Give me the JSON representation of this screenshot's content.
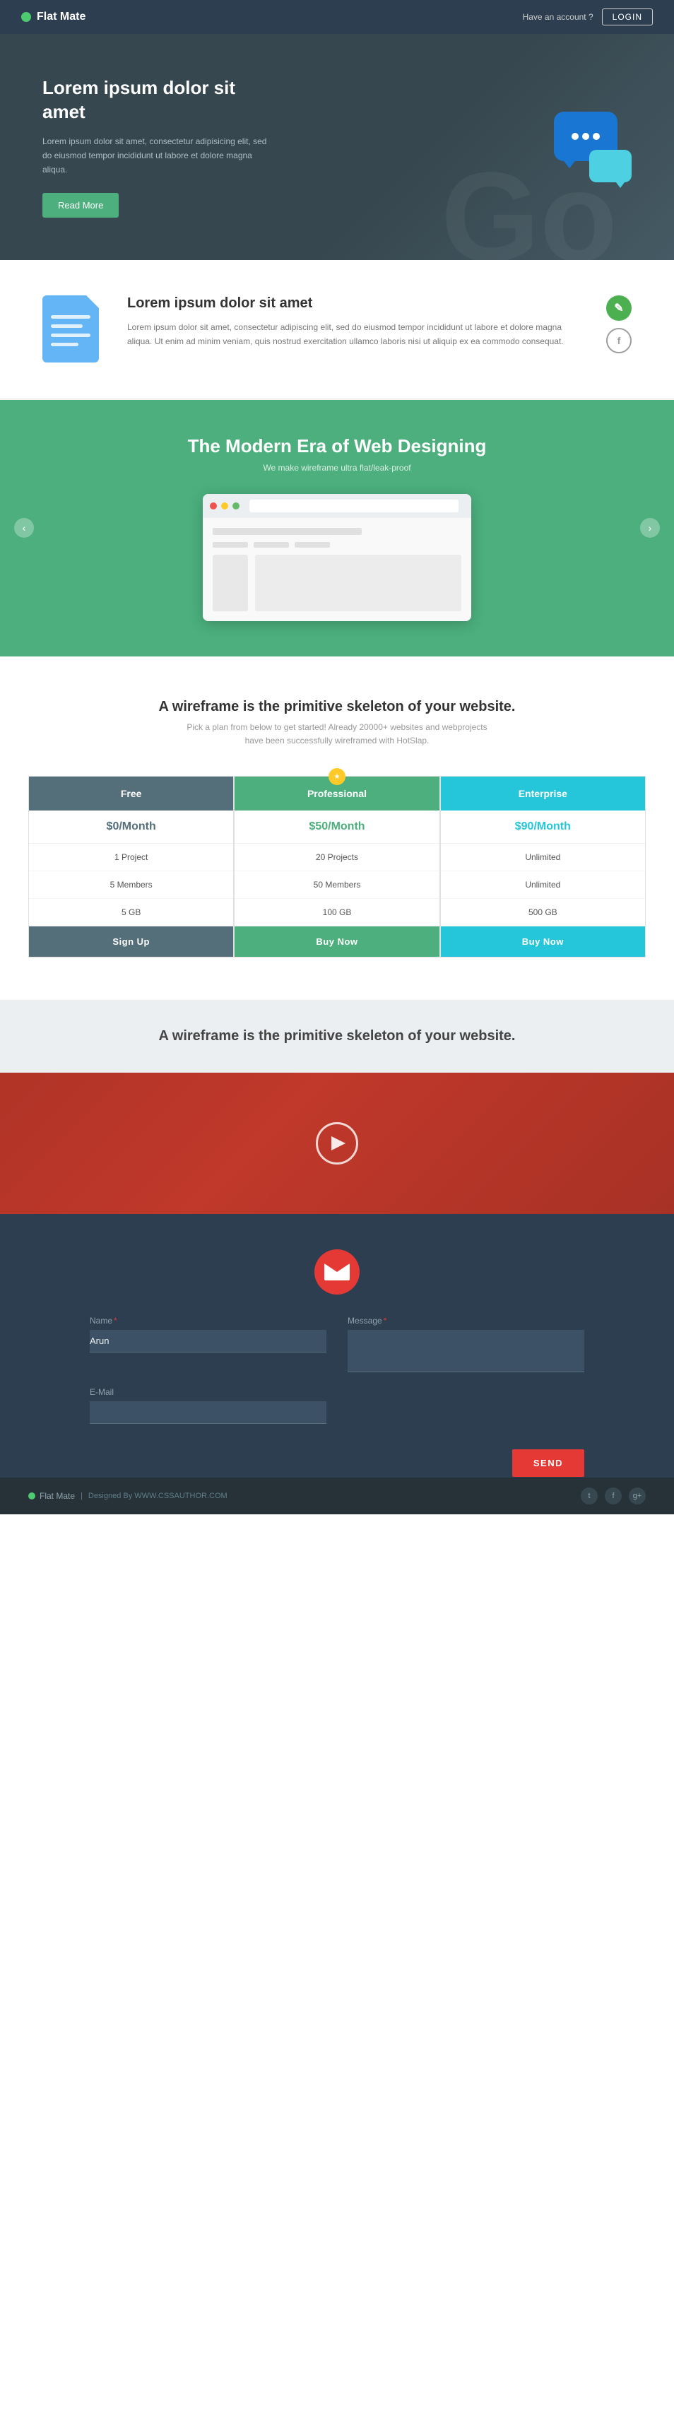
{
  "navbar": {
    "brand": "Flat Mate",
    "have_account": "Have an account ?",
    "login": "LOGIN"
  },
  "hero": {
    "title": "Lorem ipsum dolor sit amet",
    "description": "Lorem ipsum dolor sit amet, consectetur adipisicing elit, sed do eiusmod tempor incididunt ut labore et dolore magna aliqua.",
    "cta": "Read More",
    "watermark": "Go"
  },
  "feature": {
    "title": "Lorem ipsum dolor sit amet",
    "description": "Lorem ipsum dolor sit amet, consectetur adipiscing elit, sed do eiusmod tempor incididunt ut labore et dolore magna aliqua. Ut enim ad minim veniam, quis nostrud exercitation ullamco laboris nisi ut aliquip ex ea commodo consequat.",
    "edit_icon": "✎",
    "social_icon": "f"
  },
  "green_section": {
    "title": "The Modern Era of Web Designing",
    "subtitle": "We make wireframe ultra flat/leak-proof"
  },
  "pricing": {
    "title": "A wireframe is the primitive skeleton of your website.",
    "subtitle": "Pick a plan from below to get started! Already 20000+ websites and webprojects\nhave been successfully wireframed with HotSlap.",
    "plans": [
      {
        "name": "Free",
        "price": "$0/Month",
        "features": [
          "1 Project",
          "5 Members",
          "5 GB"
        ],
        "cta": "Sign Up",
        "type": "free"
      },
      {
        "name": "Professional",
        "price": "$50/Month",
        "features": [
          "20 Projects",
          "50 Members",
          "100 GB"
        ],
        "cta": "Buy Now",
        "type": "pro",
        "popular": true
      },
      {
        "name": "Enterprise",
        "price": "$90/Month",
        "features": [
          "Unlimited",
          "Unlimited",
          "500 GB"
        ],
        "cta": "Buy Now",
        "type": "enterprise"
      }
    ]
  },
  "tagline": {
    "text": "A wireframe is the primitive skeleton of your website."
  },
  "contact": {
    "fields": {
      "name_label": "Name",
      "name_value": "Arun",
      "email_label": "E-Mail",
      "email_placeholder": "",
      "message_label": "Message",
      "message_placeholder": ""
    },
    "send_btn": "SEND"
  },
  "footer": {
    "brand": "Flat Mate",
    "designed_by": "Designed By WWW.CSSAUTHOR.COM",
    "socials": [
      "t",
      "f",
      "g+"
    ]
  }
}
